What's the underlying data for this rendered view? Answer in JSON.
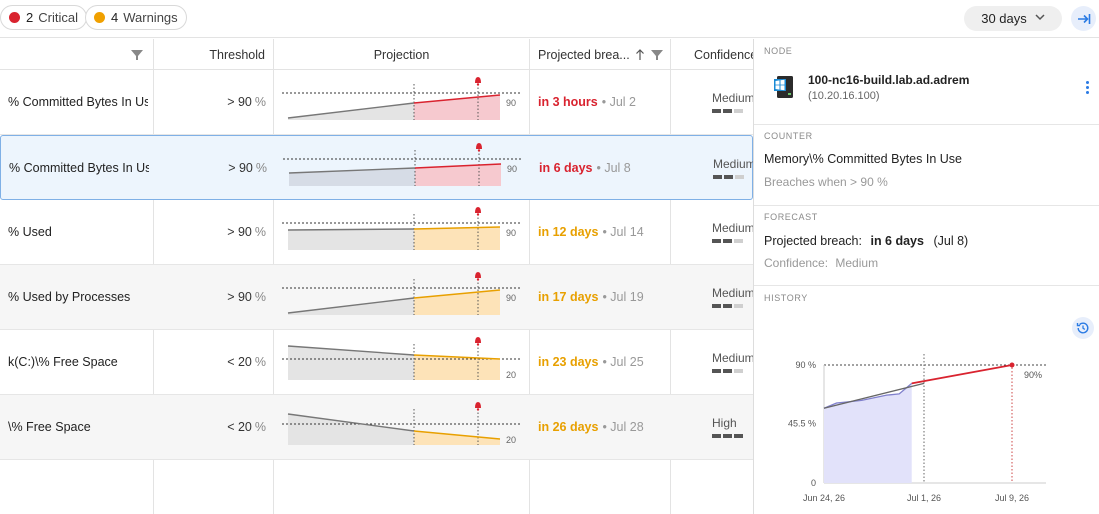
{
  "filters": {
    "critical": {
      "count": "2",
      "label": "Critical",
      "color": "#d9232f"
    },
    "warnings": {
      "count": "4",
      "label": "Warnings",
      "color": "#f0a000"
    }
  },
  "period": {
    "label": "30 days"
  },
  "table": {
    "headers": {
      "threshold": "Threshold",
      "projection": "Projection",
      "breach": "Projected brea...",
      "confidence": "Confidence"
    },
    "rows": [
      {
        "counter": "% Committed Bytes In Use",
        "threshold": "> 90",
        "unit": "%",
        "limit_label": "90",
        "severity": "critical",
        "when": "in 3 hours",
        "date": "• Jul 2",
        "confidence": "Medium",
        "conf_level": 2,
        "trend": "up"
      },
      {
        "counter": "% Committed Bytes In Use",
        "threshold": "> 90",
        "unit": "%",
        "limit_label": "90",
        "severity": "critical",
        "when": "in 6 days",
        "date": "• Jul 8",
        "confidence": "Medium",
        "conf_level": 2,
        "trend": "up-slight",
        "selected": true
      },
      {
        "counter": "% Used",
        "threshold": "> 90",
        "unit": "%",
        "limit_label": "90",
        "severity": "warning",
        "when": "in 12 days",
        "date": "• Jul 14",
        "confidence": "Medium",
        "conf_level": 2,
        "trend": "flat"
      },
      {
        "counter": "% Used by Processes",
        "threshold": "> 90",
        "unit": "%",
        "limit_label": "90",
        "severity": "warning",
        "when": "in 17 days",
        "date": "• Jul 19",
        "confidence": "Medium",
        "conf_level": 2,
        "trend": "up"
      },
      {
        "counter": "k(C:)\\% Free Space",
        "threshold": "< 20",
        "unit": "%",
        "limit_label": "20",
        "severity": "warning",
        "when": "in 23 days",
        "date": "• Jul 25",
        "confidence": "Medium",
        "conf_level": 2,
        "trend": "down"
      },
      {
        "counter": "\\% Free Space",
        "threshold": "< 20",
        "unit": "%",
        "limit_label": "20",
        "severity": "warning",
        "when": "in 26 days",
        "date": "• Jul 28",
        "confidence": "High",
        "conf_level": 3,
        "trend": "down-steep"
      }
    ]
  },
  "panel": {
    "node_title": "NODE",
    "node_name": "100-nc16-build.lab.ad.adrem",
    "node_ip": "(10.20.16.100)",
    "counter_title": "COUNTER",
    "counter_name": "Memory\\% Committed Bytes In Use",
    "breaches_text": "Breaches when > 90 %",
    "forecast_title": "FORECAST",
    "projected_label": "Projected breach:",
    "projected_when": "in 6 days",
    "projected_date": "(Jul 8)",
    "confidence_label": "Confidence:",
    "confidence_value": "Medium",
    "history_title": "HISTORY"
  },
  "colors": {
    "critical": "#d9232f",
    "warning": "#e8a000",
    "accent": "#2a7be4"
  },
  "chart_data": {
    "type": "line",
    "y_ticks": [
      "0",
      "45.5 %",
      "90 %"
    ],
    "x_ticks": [
      "Jun 24, 26",
      "Jul 1, 26",
      "Jul 9, 26"
    ],
    "ylim": [
      0,
      90
    ],
    "threshold_label": "90%",
    "series": [
      {
        "x": [
          "Jun 24",
          "Jun 25",
          "Jun 26",
          "Jun 27",
          "Jun 28",
          "Jun 29",
          "Jun 30",
          "Jul 1"
        ],
        "values": [
          57,
          61,
          62,
          63,
          65,
          67,
          68,
          76
        ]
      },
      {
        "x": [
          "Jul 1",
          "Jul 9"
        ],
        "values": [
          76,
          90
        ]
      }
    ]
  }
}
